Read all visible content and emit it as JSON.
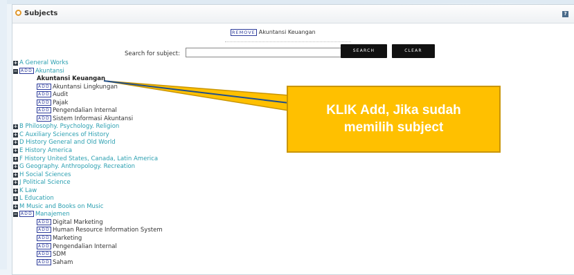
{
  "panel": {
    "title": "Subjects",
    "help_label": "?"
  },
  "selected": {
    "remove_label": "REMOVE",
    "subject": "Akuntansi Keuangan"
  },
  "search": {
    "label": "Search for subject:",
    "value": "",
    "search_label": "SEARCH",
    "clear_label": "CLEAR"
  },
  "tree": [
    {
      "type": "top",
      "label": "A General Works"
    },
    {
      "type": "open",
      "add_label": "ADD",
      "label": "Akuntansi"
    },
    {
      "type": "current",
      "label": "Akuntansi Keuangan"
    },
    {
      "type": "sub",
      "add_label": "ADD",
      "label": "Akuntansi Lingkungan"
    },
    {
      "type": "sub",
      "add_label": "ADD",
      "label": "Audit"
    },
    {
      "type": "sub",
      "add_label": "ADD",
      "label": "Pajak"
    },
    {
      "type": "sub",
      "add_label": "ADD",
      "label": "Pengendalian Internal"
    },
    {
      "type": "sub",
      "add_label": "ADD",
      "label": "Sistem Informasi Akuntansi"
    },
    {
      "type": "top",
      "label": "B Philosophy. Psychology. Religion"
    },
    {
      "type": "top",
      "label": "C Auxiliary Sciences of History"
    },
    {
      "type": "top",
      "label": "D History General and Old World"
    },
    {
      "type": "top",
      "label": "E History America"
    },
    {
      "type": "top",
      "label": "F History United States, Canada, Latin America"
    },
    {
      "type": "top",
      "label": "G Geography. Anthropology. Recreation"
    },
    {
      "type": "top",
      "label": "H Social Sciences"
    },
    {
      "type": "top",
      "label": "J Political Science"
    },
    {
      "type": "top",
      "label": "K Law"
    },
    {
      "type": "top",
      "label": "L Education"
    },
    {
      "type": "top",
      "label": "M Music and Books on Music"
    },
    {
      "type": "open",
      "add_label": "ADD",
      "label": "Manajemen"
    },
    {
      "type": "sub",
      "add_label": "ADD",
      "label": "Digital Marketing"
    },
    {
      "type": "sub",
      "add_label": "ADD",
      "label": "Human Resource Information System"
    },
    {
      "type": "sub",
      "add_label": "ADD",
      "label": "Marketing"
    },
    {
      "type": "sub",
      "add_label": "ADD",
      "label": "Pengendalian Internal"
    },
    {
      "type": "sub",
      "add_label": "ADD",
      "label": "SDM"
    },
    {
      "type": "sub",
      "add_label": "ADD",
      "label": "Saham"
    }
  ],
  "callout": {
    "line1": "KLIK Add, Jika sudah",
    "line2": "memilih subject"
  },
  "colors": {
    "callout": "#ffc000",
    "link": "#2a9fb0",
    "add_border": "#2b3a9a"
  }
}
